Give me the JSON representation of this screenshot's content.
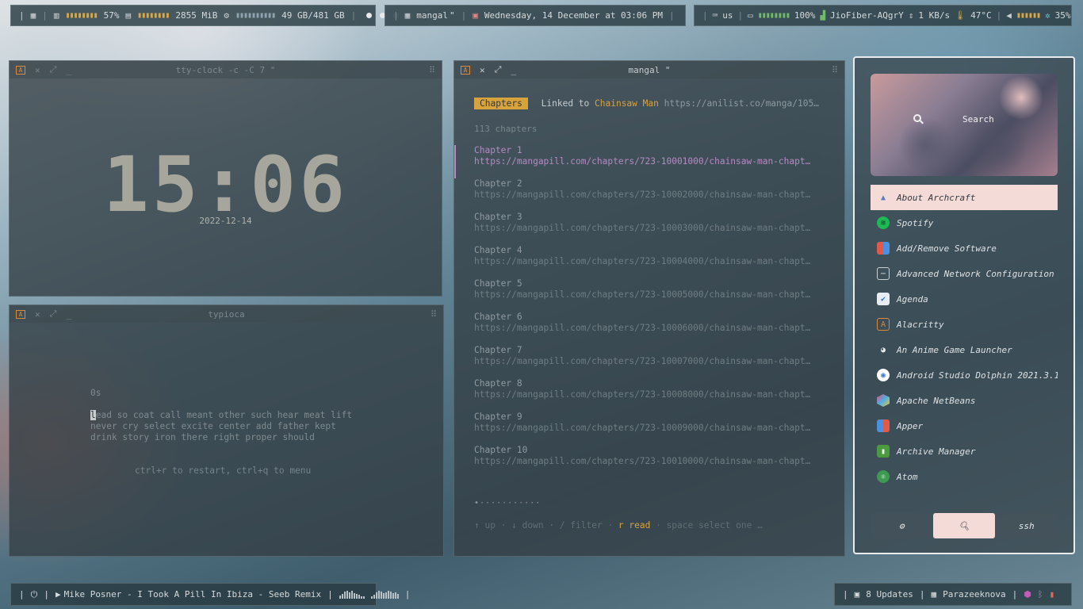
{
  "topbar_left": {
    "cpu": "57%",
    "memory": "2855 MiB",
    "disk": "49 GB/481 GB"
  },
  "topbar_center": {
    "workspace": "mangal",
    "workspace_suffix": "\"",
    "date": "Wednesday, 14 December at 03:06 PM"
  },
  "topbar_right": {
    "keyboard": "us",
    "battery": "100%",
    "wifi": "JioFiber-AQgrY",
    "net_speed": "1 KB/s",
    "temp": "47°C",
    "volume": "35%"
  },
  "clock_window": {
    "title": "tty-clock -c -C 7 \"",
    "time": "15:06",
    "date": "2022-12-14"
  },
  "typioca_window": {
    "title": "typioca",
    "timer": "0s",
    "cursor_char": "l",
    "line1_rest": "ead so coat call meant other such hear meat lift",
    "line2": "never cry select excite center add father kept",
    "line3": "drink story iron there right proper should",
    "hint": "ctrl+r to restart, ctrl+q to menu"
  },
  "mangal_window": {
    "title": "mangal \"",
    "tag": "Chapters",
    "linked_prefix": "Linked to",
    "manga_title": "Chainsaw Man",
    "link_url": "https://anilist.co/manga/105…",
    "count": "113 chapters",
    "chapters": [
      {
        "name": "Chapter 1",
        "url": "https://mangapill.com/chapters/723-10001000/chainsaw-man-chapt…"
      },
      {
        "name": "Chapter 2",
        "url": "https://mangapill.com/chapters/723-10002000/chainsaw-man-chapt…"
      },
      {
        "name": "Chapter 3",
        "url": "https://mangapill.com/chapters/723-10003000/chainsaw-man-chapt…"
      },
      {
        "name": "Chapter 4",
        "url": "https://mangapill.com/chapters/723-10004000/chainsaw-man-chapt…"
      },
      {
        "name": "Chapter 5",
        "url": "https://mangapill.com/chapters/723-10005000/chainsaw-man-chapt…"
      },
      {
        "name": "Chapter 6",
        "url": "https://mangapill.com/chapters/723-10006000/chainsaw-man-chapt…"
      },
      {
        "name": "Chapter 7",
        "url": "https://mangapill.com/chapters/723-10007000/chainsaw-man-chapt…"
      },
      {
        "name": "Chapter 8",
        "url": "https://mangapill.com/chapters/723-10008000/chainsaw-man-chapt…"
      },
      {
        "name": "Chapter 9",
        "url": "https://mangapill.com/chapters/723-10009000/chainsaw-man-chapt…"
      },
      {
        "name": "Chapter 10",
        "url": "https://mangapill.com/chapters/723-10010000/chainsaw-man-chapt…"
      }
    ],
    "pager": "•···········",
    "help_up": "↑ up",
    "help_down": "↓ down",
    "help_filter": "/ filter",
    "help_read": "r read",
    "help_space": "space select one …"
  },
  "launcher": {
    "search_placeholder": "Search",
    "apps": [
      {
        "name": "About Archcraft",
        "icon": "archcraft-icon"
      },
      {
        "name": "Spotify",
        "icon": "spotify-icon"
      },
      {
        "name": "Add/Remove Software",
        "icon": "software-icon"
      },
      {
        "name": "Advanced Network Configuration",
        "icon": "network-icon"
      },
      {
        "name": "Agenda",
        "icon": "checkbox-icon"
      },
      {
        "name": "Alacritty",
        "icon": "alacritty-icon"
      },
      {
        "name": "An Anime Game Launcher",
        "icon": "anime-launcher-icon"
      },
      {
        "name": "Android Studio Dolphin 2021.3.1…",
        "icon": "android-studio-icon"
      },
      {
        "name": "Apache NetBeans",
        "icon": "netbeans-icon"
      },
      {
        "name": "Apper",
        "icon": "apper-icon"
      },
      {
        "name": "Archive Manager",
        "icon": "archive-icon"
      },
      {
        "name": "Atom",
        "icon": "atom-icon"
      }
    ],
    "btn_ssh": "ssh"
  },
  "bottombar_left": {
    "now_playing": "Mike Posner - I Took A Pill In Ibiza - Seeb Remix"
  },
  "bottombar_right": {
    "updates": "8 Updates",
    "user": "Parazeeknova"
  },
  "colors": {
    "accent_yellow": "#d9a33b",
    "selection_purple": "#b58ac4",
    "launcher_select": "#f5dbd7"
  }
}
